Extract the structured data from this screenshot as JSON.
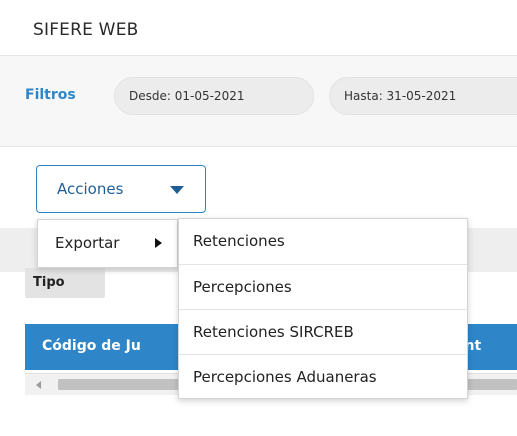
{
  "app": {
    "title": "SIFERE WEB"
  },
  "filters": {
    "label": "Filtros",
    "desde": "Desde: 01-05-2021",
    "hasta": "Hasta: 31-05-2021"
  },
  "toolbar": {
    "acciones_label": "Acciones"
  },
  "menu": {
    "exportar_label": "Exportar",
    "submenu": [
      "Retenciones",
      "Percepciones",
      "Retenciones SIRCREB",
      "Percepciones Aduaneras"
    ]
  },
  "grouping": {
    "tipo_label": "Tipo"
  },
  "table": {
    "columns": [
      "Código de Ju",
      "gent"
    ]
  },
  "colors": {
    "accent": "#2e86c9",
    "header_bg": "#2e86c9"
  }
}
